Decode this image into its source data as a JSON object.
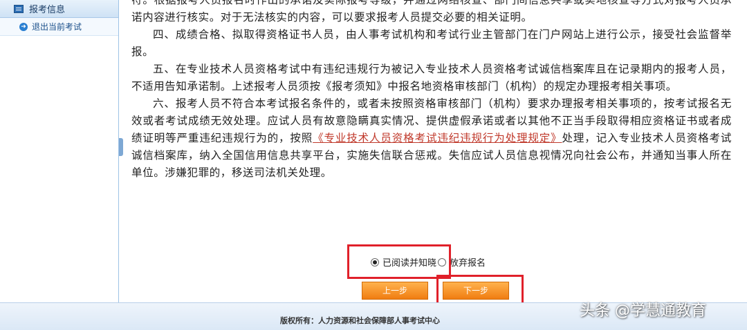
{
  "sidebar": {
    "header": "报考信息",
    "items": [
      {
        "label": "退出当前考试"
      }
    ]
  },
  "content": {
    "p0": "符。根据报考人员报名时作出的承诺及实际报考等级，并通过网络核查、部门间信息共享或实地核查等方式对报考人员承诺内容进行核实。对于无法核实的内容，可以要求报考人员提交必要的相关证明。",
    "p4": "四、成绩合格、拟取得资格证书人员，由人事考试机构和考试行业主管部门在门户网站上进行公示，接受社会监督举报。",
    "p5": "五、在专业技术人员资格考试中有违纪违规行为被记入专业技术人员资格考试诚信档案库且在记录期内的报考人员，不适用告知承诺制。上述报考人员须按《报考须知》中报名地资格审核部门（机构）的规定办理报考相关事项。",
    "p6_before": "六、报考人员不符合本考试报名条件的，或者未按照资格审核部门（机构）要求办理报考相关事项的，按考试报名无效或者考试成绩无效处理。应试人员有故意隐瞒真实情况、提供虚假承诺或者以其他不正当手段取得相应资格证书或者成绩证明等严重违纪违规行为的，按照",
    "p6_link": "《专业技术人员资格考试违纪违规行为处理规定》",
    "p6_after": "处理，记入专业技术人员资格考试诚信档案库，纳入全国信用信息共享平台，实施失信联合惩戒。失信应试人员信息视情况向社会公布，并通知当事人所在单位。涉嫌犯罪的，移送司法机关处理。"
  },
  "choices": {
    "agree": "已阅读并知晓",
    "abandon": "放弃报名",
    "selected": "agree"
  },
  "buttons": {
    "prev": "上一步",
    "next": "下一步"
  },
  "footer": {
    "copyright": "版权所有：人力资源和社会保障部人事考试中心"
  },
  "watermark": "头条 @学慧通教育",
  "colors": {
    "highlight": "#e0202a",
    "button": "#f08a1c",
    "link": "#c0392b"
  }
}
